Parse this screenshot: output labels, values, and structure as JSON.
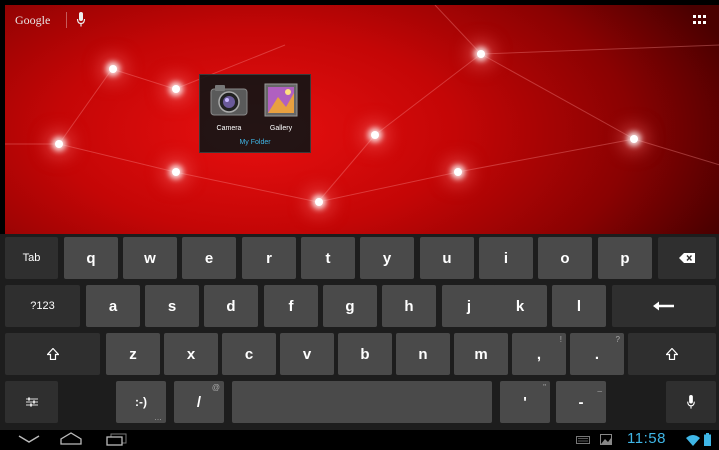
{
  "search_bar": {
    "brand": "Google"
  },
  "folder": {
    "name": "My Folder",
    "items": [
      {
        "label": "Camera",
        "icon": "camera-icon"
      },
      {
        "label": "Gallery",
        "icon": "gallery-icon"
      }
    ]
  },
  "keyboard": {
    "row1": {
      "tab": "Tab",
      "keys": [
        "q",
        "w",
        "e",
        "r",
        "t",
        "y",
        "u",
        "i",
        "o",
        "p"
      ]
    },
    "row2": {
      "symbols": "?123",
      "keys": [
        "a",
        "s",
        "d",
        "f",
        "g",
        "h",
        "j",
        "k",
        "l"
      ]
    },
    "row3": {
      "keys": [
        "z",
        "x",
        "c",
        "v",
        "b",
        "n",
        "m"
      ],
      "comma": ",",
      "comma_hint": "!",
      "period": ".",
      "period_hint": "?"
    },
    "row4": {
      "smiley": ":-)",
      "slash": "/",
      "slash_hint": "@",
      "apostrophe": "'",
      "apostrophe_hint": "\"",
      "dash": "-",
      "dash_hint": "_"
    }
  },
  "status": {
    "time": "11:58"
  },
  "colors": {
    "accent": "#3fb6e6",
    "wallpaper": "#d40808",
    "key": "#4a4a4a",
    "key_fn": "#2f2f2f"
  }
}
